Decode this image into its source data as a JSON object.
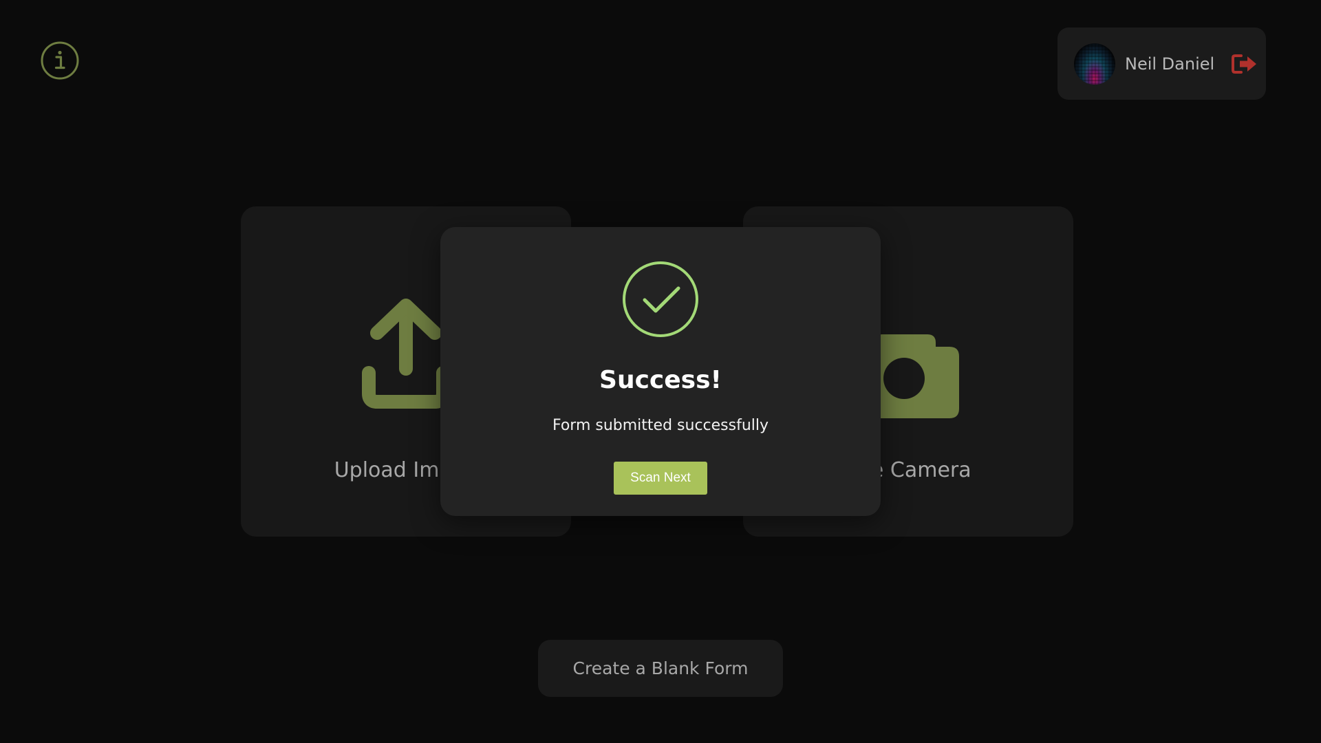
{
  "header": {
    "info_icon": "info-circle-icon",
    "user": {
      "name": "Neil Daniel",
      "avatar_icon": "avatar-image",
      "logout_icon": "logout-icon"
    }
  },
  "main": {
    "cards": [
      {
        "label": "Upload Image",
        "icon": "upload-icon"
      },
      {
        "label": "Use Camera",
        "icon": "camera-icon"
      }
    ],
    "blank_form_label": "Create a Blank Form"
  },
  "modal": {
    "icon": "check-circle-icon",
    "title": "Success!",
    "message": "Form submitted successfully",
    "button_label": "Scan Next"
  },
  "colors": {
    "accent_olive": "#6e7d41",
    "success_green": "#a3d977",
    "button_green": "#a9c25a",
    "logout_red": "#b0312c",
    "background": "#0b0b0b",
    "card_bg": "#181818",
    "modal_bg": "#232323"
  }
}
